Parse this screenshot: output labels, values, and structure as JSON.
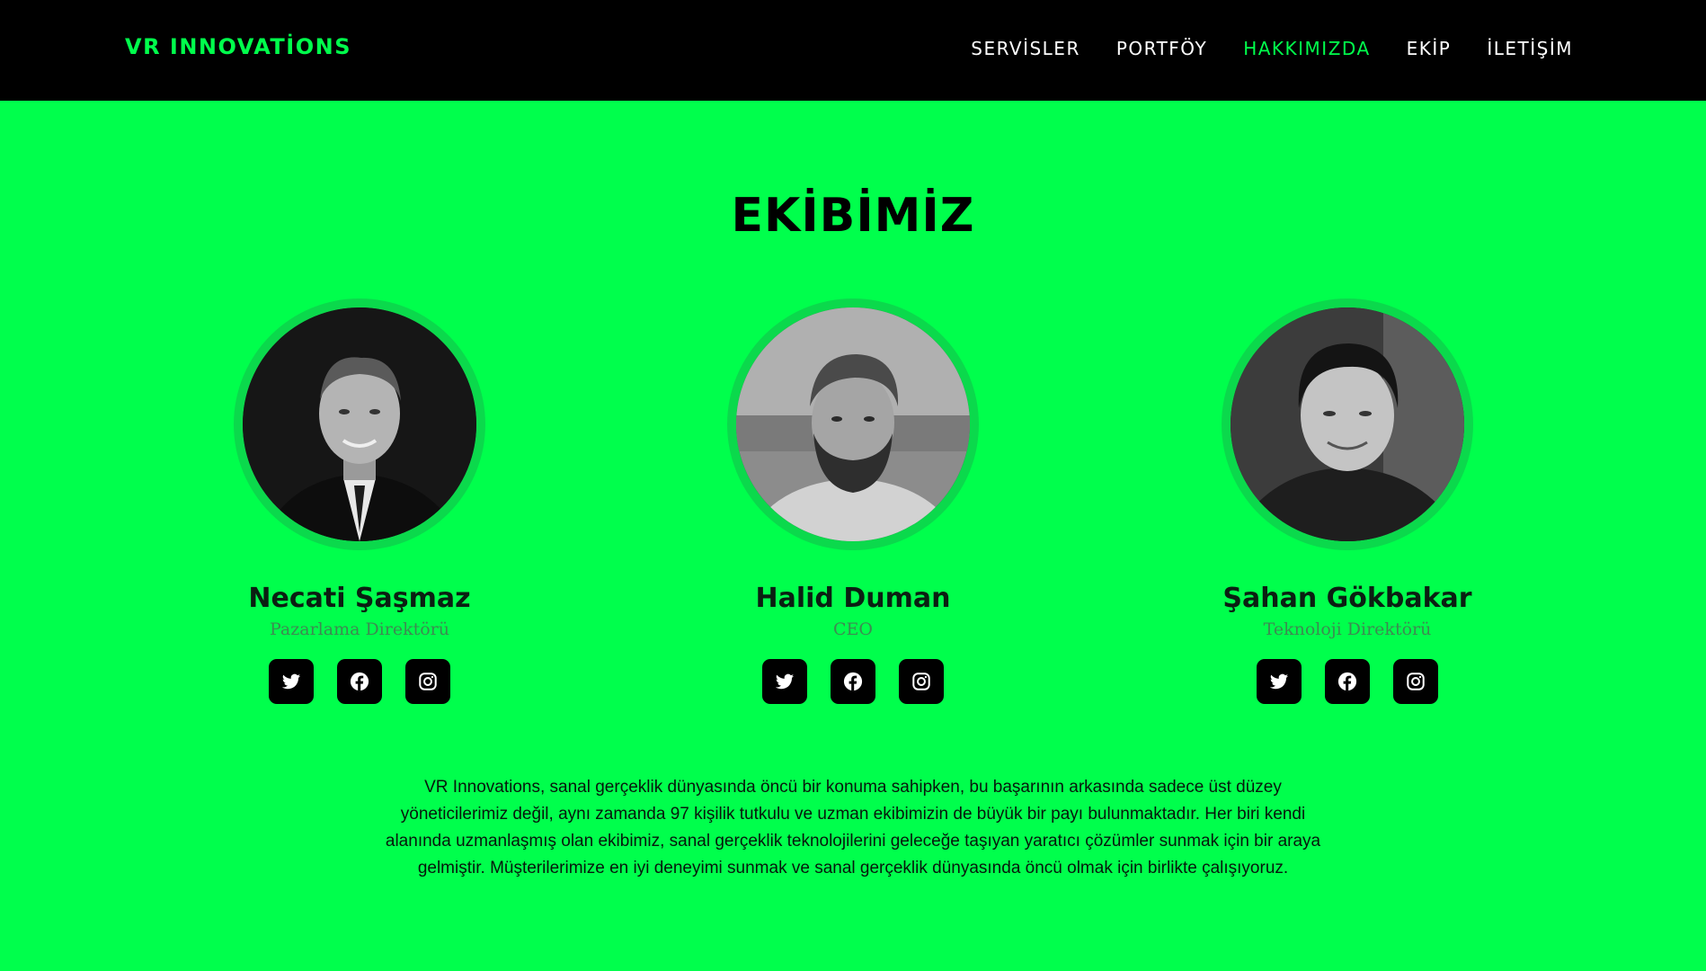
{
  "header": {
    "brand": "VR INNOVATİONS",
    "nav": [
      {
        "label": "SERVİSLER",
        "active": false
      },
      {
        "label": "PORTFÖY",
        "active": false
      },
      {
        "label": "HAKKIMIZDA",
        "active": true
      },
      {
        "label": "EKİP",
        "active": false
      },
      {
        "label": "İLETİŞİM",
        "active": false
      }
    ]
  },
  "team": {
    "title": "EKİBİMİZ",
    "members": [
      {
        "name": "Necati Şaşmaz",
        "role": "Pazarlama Direktörü",
        "socials": [
          "twitter-icon",
          "facebook-icon",
          "instagram-icon"
        ]
      },
      {
        "name": "Halid Duman",
        "role": "CEO",
        "socials": [
          "twitter-icon",
          "facebook-icon",
          "instagram-icon"
        ]
      },
      {
        "name": "Şahan Gökbakar",
        "role": "Teknoloji Direktörü",
        "socials": [
          "twitter-icon",
          "facebook-icon",
          "instagram-icon"
        ]
      }
    ],
    "description": "VR Innovations, sanal gerçeklik dünyasında öncü bir konuma sahipken, bu başarının arkasında sadece üst düzey yöneticilerimiz değil, aynı zamanda 97 kişilik tutkulu ve uzman ekibimizin de büyük bir payı bulunmaktadır. Her biri kendi alanında uzmanlaşmış olan ekibimiz, sanal gerçeklik teknolojilerini geleceğe taşıyan yaratıcı çözümler sunmak için bir araya gelmiştir. Müşterilerimize en iyi deneyimi sunmak ve sanal gerçeklik dünyasında öncü olmak için birlikte çalışıyoruz."
  },
  "colors": {
    "accent": "#00ff4c",
    "ring": "#0bd94c",
    "navbar": "#000000",
    "role_text": "#3d8a52"
  }
}
